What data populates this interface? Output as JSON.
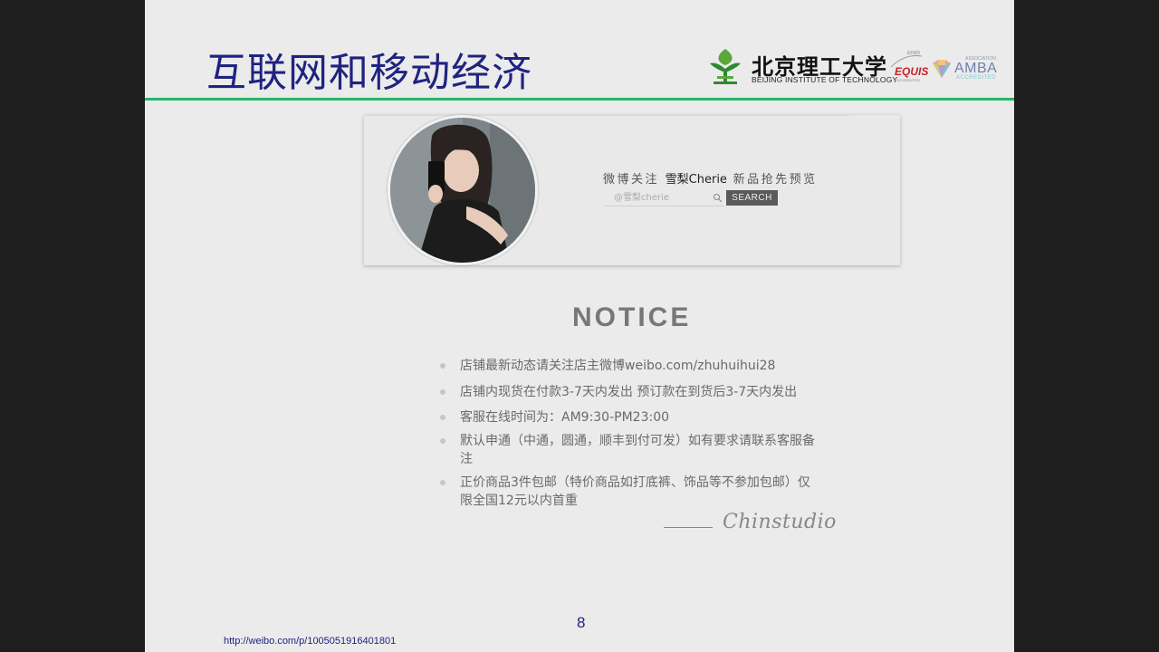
{
  "slide": {
    "title": "互联网和移动经济",
    "page_number": "8",
    "source_url": "http://weibo.com/p/1005051916401801"
  },
  "logos": {
    "bit_name_zh": "北京理工大学",
    "bit_name_en": "BEIJING INSTITUTE OF TECHNOLOGY",
    "equis_top": "EFMD",
    "equis": "EQUIS",
    "equis_sub": "ACCREDITED",
    "amba_top": "ASSOCIATION",
    "amba": "AMBA",
    "amba_sub": "ACCREDITED"
  },
  "banner": {
    "weibo_prefix": "微博关注",
    "weibo_name": "雪梨Cherie",
    "weibo_suffix": "新品抢先预览",
    "search_placeholder": "@雪梨cherie",
    "search_button": "SEARCH"
  },
  "notice": {
    "title": "NOTICE",
    "items": [
      "店铺最新动态请关注店主微博weibo.com/zhuhuihui28",
      "店铺内现货在付款3-7天内发出 预订款在到货后3-7天内发出",
      "客服在线时间为：AM9:30-PM23:00",
      "默认申通（中通，圆通，顺丰到付可发）如有要求请联系客服备注",
      "正价商品3件包邮（特价商品如打底裤、饰品等不参加包邮）仅限全国12元以内首重"
    ],
    "signature": "Chinstudio"
  },
  "colors": {
    "title": "#1f2380",
    "divider": "#27b46a",
    "slide_bg": "#ebebeb",
    "outer_bg": "#1e1e1e"
  }
}
